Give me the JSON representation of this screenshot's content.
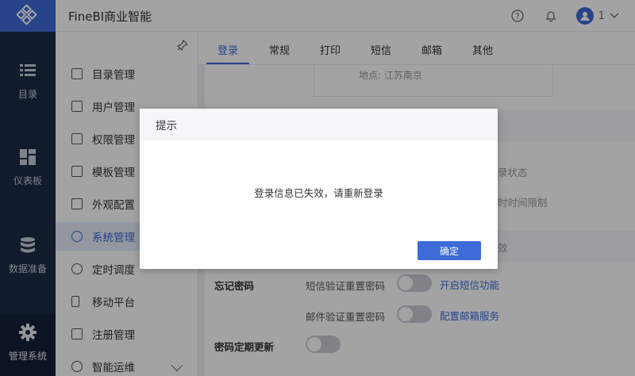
{
  "app": {
    "title": "FineBI商业智能",
    "user_name": "1"
  },
  "rail": [
    {
      "label": "目录",
      "icon": "list-icon"
    },
    {
      "label": "仪表板",
      "icon": "dashboard-icon"
    },
    {
      "label": "数据准备",
      "icon": "database-icon"
    },
    {
      "label": "管理系统",
      "icon": "gear-icon"
    }
  ],
  "menu": [
    {
      "label": "目录管理"
    },
    {
      "label": "用户管理"
    },
    {
      "label": "权限管理"
    },
    {
      "label": "模板管理"
    },
    {
      "label": "外观配置"
    },
    {
      "label": "系统管理"
    },
    {
      "label": "定时调度"
    },
    {
      "label": "移动平台"
    },
    {
      "label": "注册管理"
    },
    {
      "label": "智能运维"
    }
  ],
  "tabs": [
    {
      "label": "登录"
    },
    {
      "label": "常规"
    },
    {
      "label": "打印"
    },
    {
      "label": "短信"
    },
    {
      "label": "邮箱"
    },
    {
      "label": "其他"
    }
  ],
  "content": {
    "faint_top": "地点:    江苏南京",
    "faint_status": "录状态",
    "faint_time": "时时间限制",
    "faint_effect": "效",
    "forgot_pwd": "忘记密码",
    "sms_reset": "短信验证重置密码",
    "sms_link": "开启短信功能",
    "mail_reset": "邮件验证重置密码",
    "mail_link": "配置邮箱服务",
    "pwd_update": "密码定期更新"
  },
  "dialog": {
    "title": "提示",
    "message": "登录信息已失效，请重新登录",
    "ok_label": "确定"
  },
  "colors": {
    "accent": "#3d6bd8",
    "rail": "#1d2b45"
  }
}
